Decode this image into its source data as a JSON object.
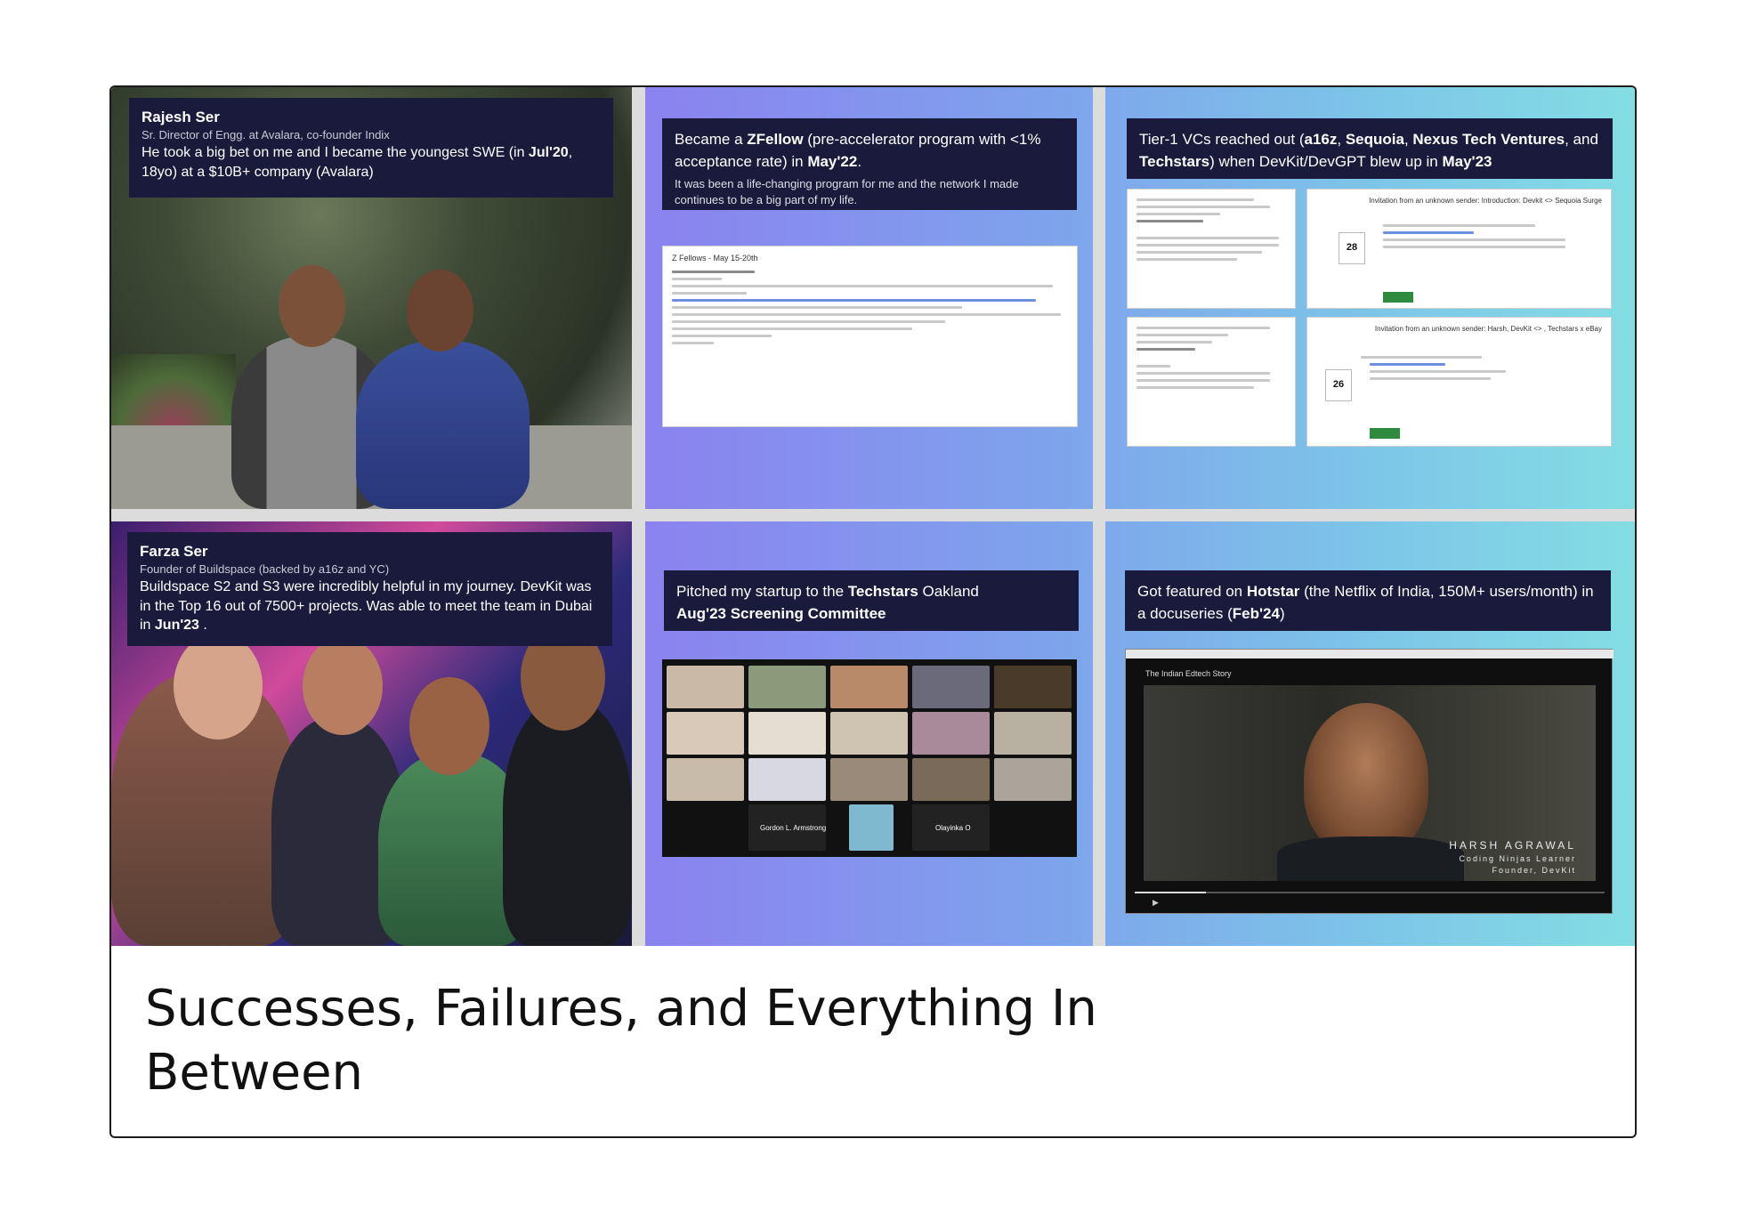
{
  "panels": {
    "p1": {
      "name": "Rajesh Ser",
      "role": "Sr. Director of Engg. at Avalara, co-founder Indix",
      "text_a": "He took a big bet on me and I became the youngest SWE (in ",
      "text_b": "Jul'20",
      "text_c": ", 18yo) at a $10B+ company (Avalara)"
    },
    "p2": {
      "text_a": "Became a ",
      "text_b": "ZFellow",
      "text_c": " (pre-accelerator program with <1% acceptance rate) in ",
      "text_d": "May'22",
      "text_e": ".",
      "small": "It was been a life-changing program for me and the network I made continues to be a big part of my life.",
      "doc_title": "Z Fellows - May 15-20th"
    },
    "p3": {
      "text_a": "Tier-1 VCs reached out (",
      "text_b": "a16z",
      "text_c": ", ",
      "text_d": "Sequoia",
      "text_e": ", ",
      "text_f": "Nexus Tech Ventures",
      "text_g": ", and ",
      "text_h": "Techstars",
      "text_i": ") when DevKit/DevGPT blew up in ",
      "text_j": "May'23",
      "inv1": "Invitation from an unknown sender: Introduction: Devkit <> Sequoia Surge",
      "inv1_date": "28",
      "inv2": "Invitation from an unknown sender: Harsh, DevKit <> , Techstars x eBay",
      "inv2_date": "26"
    },
    "p4": {
      "name": "Farza Ser",
      "role": "Founder of Buildspace (backed by a16z and YC)",
      "text_a": "Buildspace S2 and S3 were incredibly helpful in my journey. DevKit was in the Top 16 out of 7500+ projects. Was able to meet the team in Dubai in ",
      "text_b": "Jun'23",
      "text_c": " ."
    },
    "p5": {
      "text_a": "Pitched my startup to the ",
      "text_b": "Techstars",
      "text_c": " Oakland",
      "text_d": "Aug'23 Screening Committee",
      "zoom_name_1": "Gordon L. Armstrong",
      "zoom_name_2": "Olayinka O"
    },
    "p6": {
      "text_a": "Got featured on ",
      "text_b": "Hotstar",
      "text_c": " (the Netflix of India, 150M+ users/month) in a docuseries (",
      "text_d": "Feb'24",
      "text_e": ")",
      "video_title": "The Indian Edtech Story",
      "caption_name": "HARSH AGRAWAL",
      "caption_l1": "Coding Ninjas Learner",
      "caption_l2": "Founder, DevKit"
    }
  },
  "title": "Successes, Failures, and Everything In Between"
}
